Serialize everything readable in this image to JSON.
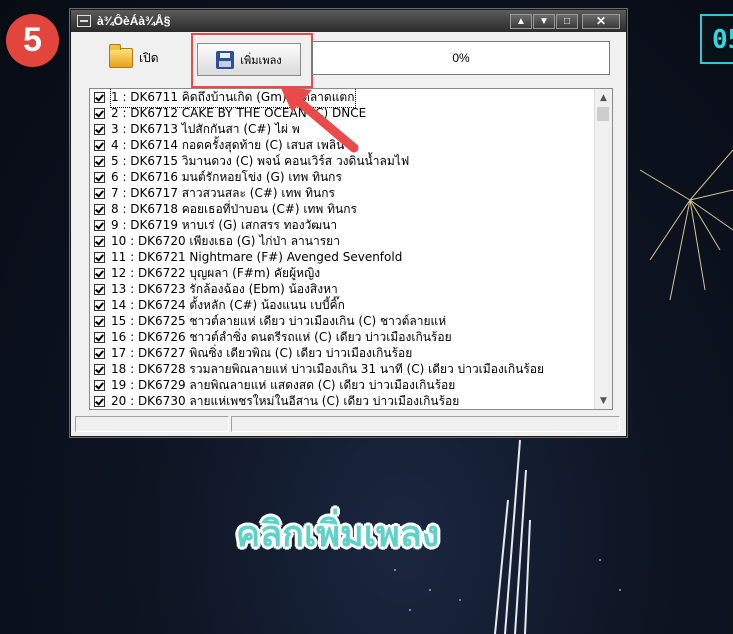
{
  "step_badge": "5",
  "window": {
    "title": "à¾ÔèÁà¾Å§",
    "buttons": {
      "minimize": "▲",
      "restore": "▼",
      "maximize": "□",
      "close": "✕"
    }
  },
  "toolbar": {
    "open_label": "เปิด",
    "add_label": "เพิ่มเพลง",
    "progress_text": "0%",
    "progress_value": 0
  },
  "songs": [
    "1 : DK6711 คิดถึงบ้านเกิด (Gm) ดิ ตลาดแตก",
    "2 : DK6712 CAKE BY THE OCEAN (C) DNCE",
    "3 : DK6713 ไปสักกันสา (C#) ไผ่ พ",
    "4 : DK6714 กอดครั้งสุดท้าย (C) เสบส เพลิน",
    "5 : DK6715 วิมานดวง (C) พจน์ คอนเวิร์ส วงดินน้ำลมไฟ",
    "6 : DK6716 มนต์รักหอยโข่ง (G) เทพ ทินกร",
    "7 : DK6717 สาวสวนสละ (C#) เทพ ทินกร",
    "8 : DK6718 คอยเธอที่ป่าบอน (C#) เทพ ทินกร",
    "9 : DK6719 หาบเร่ (G) เสกสรร ทองวัฒนา",
    "10 : DK6720 เพียงเธอ (G) ไก่ป่า ลานารยา",
    "11 : DK6721 Nightmare (F#) Avenged Sevenfold",
    "12 : DK6722 บุญผลา (F#m) คัยผู้หญิง",
    "13 : DK6723 รักล้องฉ้อง (Ebm) น้องสิงหา",
    "14 : DK6724 ตั้งหลัก (C#) น้องแนน เบบี้คิ๊ก",
    "15 : DK6725 ชาวต์ลายแห่ เดียว บ่าวเมืองเกิน (C) ชาวต์ลายแห่",
    "16 : DK6726 ชาวต์ลำซิ่ง ดนตรีรถแห่ (C) เดียว บ่าวเมืองเกินร้อย",
    "17 : DK6727 พิณซิ่ง เดียวพิณ (C) เดียว บ่าวเมืองเกินร้อย",
    "18 : DK6728 รวมลายพิณลายแห่ บ่าวเมืองเกิน 31 นาที (C) เดียว บ่าวเมืองเกินร้อย",
    "19 : DK6729 ลายพิณลายแห่ แสดงสด (C) เดียว บ่าวเมืองเกินร้อย",
    "20 : DK6730 ลายแห่เพชรใหม่ในอีสาน (C) เดียว บ่าวเมืองเกินร้อย"
  ],
  "caption": "คลิกเพิ่มเพลง",
  "clock_partial": "05",
  "colors": {
    "highlight": "#e94a4a",
    "arrow": "#e94a4a",
    "badge": "#e2453b",
    "caption": "#5fd2c8"
  }
}
